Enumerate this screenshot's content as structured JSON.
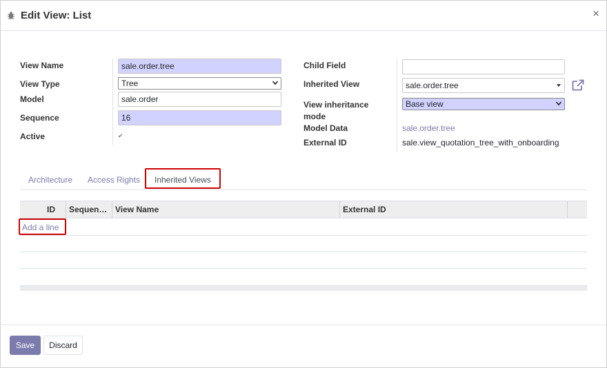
{
  "dialog": {
    "title": "Edit View: List",
    "close_glyph": "×",
    "icon": "bug-icon"
  },
  "form": {
    "view_name": {
      "label": "View Name",
      "value": "sale.order.tree"
    },
    "view_type": {
      "label": "View Type",
      "value": "Tree"
    },
    "model": {
      "label": "Model",
      "value": "sale.order"
    },
    "sequence": {
      "label": "Sequence",
      "value": "16"
    },
    "active": {
      "label": "Active",
      "checked": true,
      "glyph": "✔"
    },
    "child_field": {
      "label": "Child Field",
      "value": ""
    },
    "inherited_view": {
      "label": "Inherited View",
      "value": "sale.order.tree",
      "external_link_icon": "external-link-icon"
    },
    "inheritance_mode": {
      "label_line1": "View inheritance",
      "label_line2": "mode",
      "value": "Base view"
    },
    "model_data": {
      "label": "Model Data",
      "value": "sale.order.tree"
    },
    "external_id": {
      "label": "External ID",
      "value": "sale.view_quotation_tree_with_onboarding"
    }
  },
  "tabs": [
    {
      "label": "Architecture"
    },
    {
      "label": "Access Rights"
    },
    {
      "label": "Inherited Views",
      "active": true
    }
  ],
  "table": {
    "columns": [
      "ID",
      "Sequen…",
      "View Name",
      "External ID"
    ],
    "add_line": "Add a line",
    "rows": []
  },
  "footer": {
    "save_label": "Save",
    "discard_label": "Discard"
  },
  "colors": {
    "accent": "#7c7bad",
    "required_bg": "#d2d2ff",
    "highlight": "#cc0000"
  }
}
